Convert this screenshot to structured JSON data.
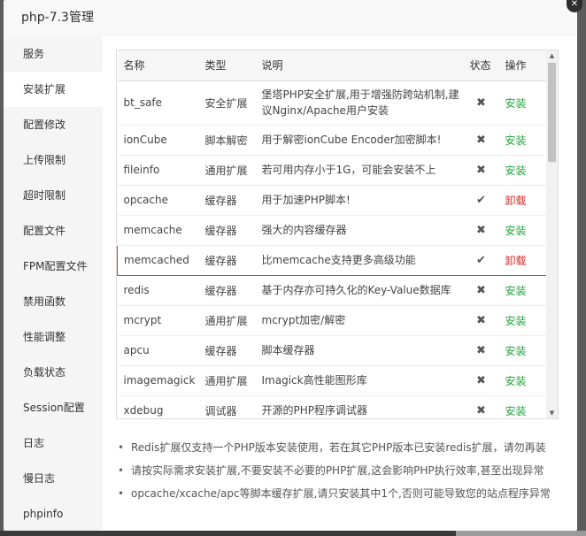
{
  "window": {
    "title": "php-7.3管理",
    "close_glyph": "✕"
  },
  "sidebar": {
    "items": [
      {
        "label": "服务",
        "active": false
      },
      {
        "label": "安装扩展",
        "active": true
      },
      {
        "label": "配置修改",
        "active": false
      },
      {
        "label": "上传限制",
        "active": false
      },
      {
        "label": "超时限制",
        "active": false
      },
      {
        "label": "配置文件",
        "active": false
      },
      {
        "label": "FPM配置文件",
        "active": false
      },
      {
        "label": "禁用函数",
        "active": false
      },
      {
        "label": "性能调整",
        "active": false
      },
      {
        "label": "负载状态",
        "active": false
      },
      {
        "label": "Session配置",
        "active": false
      },
      {
        "label": "日志",
        "active": false
      },
      {
        "label": "慢日志",
        "active": false
      },
      {
        "label": "phpinfo",
        "active": false
      }
    ]
  },
  "table": {
    "headers": {
      "name": "名称",
      "type": "类型",
      "desc": "说明",
      "status": "状态",
      "action": "操作"
    },
    "rows": [
      {
        "name": "bt_safe",
        "type": "安全扩展",
        "desc": "堡塔PHP安全扩展,用于增强防跨站机制,建议Nginx/Apache用户安装",
        "status": "✖",
        "action": "安装",
        "installed": false
      },
      {
        "name": "ionCube",
        "type": "脚本解密",
        "desc": "用于解密ionCube Encoder加密脚本!",
        "status": "✖",
        "action": "安装",
        "installed": false
      },
      {
        "name": "fileinfo",
        "type": "通用扩展",
        "desc": "若可用内存小于1G，可能会安装不上",
        "status": "✖",
        "action": "安装",
        "installed": false
      },
      {
        "name": "opcache",
        "type": "缓存器",
        "desc": "用于加速PHP脚本!",
        "status": "✔",
        "action": "卸载",
        "installed": true
      },
      {
        "name": "memcache",
        "type": "缓存器",
        "desc": "强大的内容缓存器",
        "status": "✖",
        "action": "安装",
        "installed": false
      },
      {
        "name": "memcached",
        "type": "缓存器",
        "desc": "比memcache支持更多高级功能",
        "status": "✔",
        "action": "卸载",
        "installed": true
      },
      {
        "name": "redis",
        "type": "缓存器",
        "desc": "基于内存亦可持久化的Key-Value数据库",
        "status": "✖",
        "action": "安装",
        "installed": false
      },
      {
        "name": "mcrypt",
        "type": "通用扩展",
        "desc": "mcrypt加密/解密",
        "status": "✖",
        "action": "安装",
        "installed": false
      },
      {
        "name": "apcu",
        "type": "缓存器",
        "desc": "脚本缓存器",
        "status": "✖",
        "action": "安装",
        "installed": false
      },
      {
        "name": "imagemagick",
        "type": "通用扩展",
        "desc": "Imagick高性能图形库",
        "status": "✖",
        "action": "安装",
        "installed": false
      },
      {
        "name": "xdebug",
        "type": "调试器",
        "desc": "开源的PHP程序调试器",
        "status": "✖",
        "action": "安装",
        "installed": false
      }
    ],
    "selected_row": "memcached"
  },
  "scrollbar": {
    "up_glyph": "▲",
    "down_glyph": "▼"
  },
  "notes": [
    "Redis扩展仅支持一个PHP版本安装使用，若在其它PHP版本已安装redis扩展，请勿再装",
    "请按实际需求安装扩展,不要安装不必要的PHP扩展,这会影响PHP执行效率,甚至出现异常",
    "opcache/xcache/apc等脚本缓存扩展,请只安装其中1个,否则可能导致您的站点程序异常"
  ],
  "colors": {
    "install": "#20a53a",
    "uninstall": "#e0282a",
    "selected_border": "#e33"
  }
}
